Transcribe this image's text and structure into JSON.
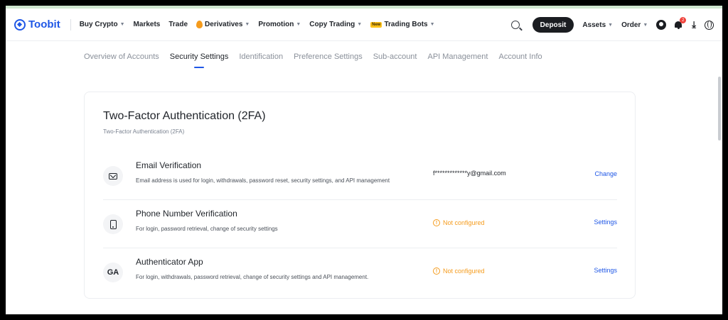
{
  "brand": {
    "name": "Toobit",
    "accent": "#1f57e6"
  },
  "topnav": {
    "items": [
      {
        "label": "Buy Crypto",
        "dropdown": true
      },
      {
        "label": "Markets",
        "dropdown": false
      },
      {
        "label": "Trade",
        "dropdown": false
      },
      {
        "label": "Derivatives",
        "dropdown": true,
        "icon": "fire-icon"
      },
      {
        "label": "Promotion",
        "dropdown": true
      },
      {
        "label": "Copy Trading",
        "dropdown": true
      },
      {
        "label": "Trading Bots",
        "dropdown": true,
        "badge": "New"
      }
    ],
    "deposit_label": "Deposit",
    "assets_label": "Assets",
    "order_label": "Order",
    "notification_count": "2",
    "icons": [
      "search-icon",
      "user-icon",
      "bell-icon",
      "download-icon",
      "globe-icon"
    ]
  },
  "subtabs": [
    {
      "label": "Overview of Accounts",
      "active": false
    },
    {
      "label": "Security Settings",
      "active": true
    },
    {
      "label": "Identification",
      "active": false
    },
    {
      "label": "Preference Settings",
      "active": false
    },
    {
      "label": "Sub-account",
      "active": false
    },
    {
      "label": "API Management",
      "active": false
    },
    {
      "label": "Account Info",
      "active": false
    }
  ],
  "section": {
    "title": "Two-Factor Authentication (2FA)",
    "subtitle": "Two-Factor Authentication (2FA)",
    "rows": [
      {
        "icon": "mail-icon",
        "title": "Email Verification",
        "desc": "Email address is used for login, withdrawals, password reset, security settings, and API management",
        "value": "f*************y@gmail.com",
        "status": "",
        "action": "Change"
      },
      {
        "icon": "phone-icon",
        "title": "Phone Number Verification",
        "desc": "For login, password retrieval, change of security settings",
        "value": "",
        "status": "Not configured",
        "action": "Settings"
      },
      {
        "icon": "ga-icon",
        "icon_text": "GA",
        "title": "Authenticator App",
        "desc": "For login, withdrawals, password retrieval, change of security settings and API management.",
        "value": "",
        "status": "Not configured",
        "action": "Settings"
      }
    ]
  },
  "colors": {
    "warning": "#f59b1c",
    "link": "#1f57e6",
    "deposit_bg": "#1b1d21"
  }
}
